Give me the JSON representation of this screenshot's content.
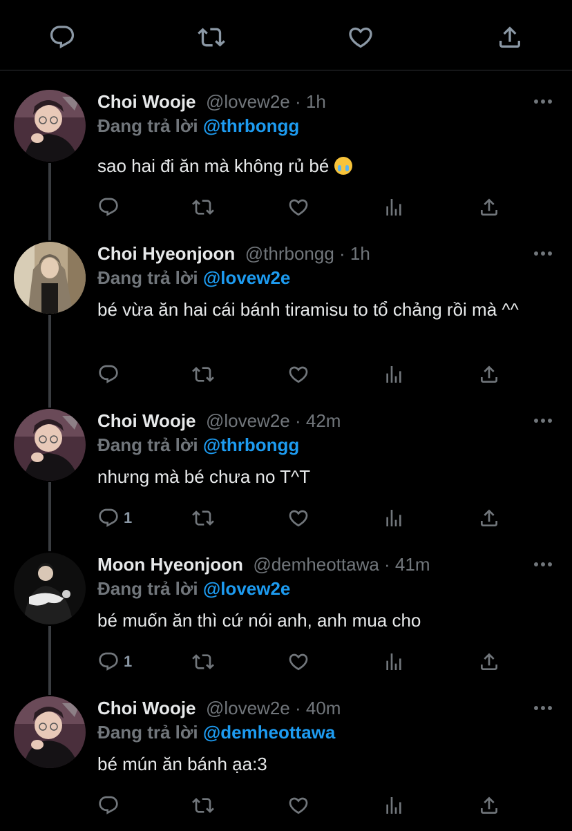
{
  "top_actions": [
    "reply-icon",
    "retweet-icon",
    "like-icon",
    "share-icon"
  ],
  "colors": {
    "background": "#000000",
    "text": "#e7e9ea",
    "muted": "#71767b",
    "mention": "#1d9bf0",
    "thread_line": "#3a3d41"
  },
  "tweets": [
    {
      "name": "Choi Wooje",
      "meta": "@lovew2e · 1h",
      "reply_prefix": "Đang trả lời",
      "reply_to": "@thrbongg",
      "text": "sao hai đi ăn mà không rủ bé",
      "emoji": "loudly-crying-face",
      "reply_count": ""
    },
    {
      "name": "Choi Hyeonjoon",
      "meta": "@thrbongg · 1h",
      "reply_prefix": "Đang trả lời",
      "reply_to": "@lovew2e",
      "text": "bé vừa ăn hai cái bánh tiramisu to tổ chảng rồi mà ^^",
      "reply_count": ""
    },
    {
      "name": "Choi Wooje",
      "meta": "@lovew2e · 42m",
      "reply_prefix": "Đang trả lời",
      "reply_to": "@thrbongg",
      "text": "nhưng mà bé chưa no T^T",
      "reply_count": "1"
    },
    {
      "name": "Moon Hyeonjoon",
      "meta": "@demheottawa · 41m",
      "reply_prefix": "Đang trả lời",
      "reply_to": "@lovew2e",
      "text": "bé muốn ăn thì cứ nói anh, anh mua cho",
      "reply_count": "1"
    },
    {
      "name": "Choi Wooje",
      "meta": "@lovew2e · 40m",
      "reply_prefix": "Đang trả lời",
      "reply_to": "@demheottawa",
      "text": "bé mún ăn bánh ạa:3",
      "reply_count": ""
    }
  ]
}
